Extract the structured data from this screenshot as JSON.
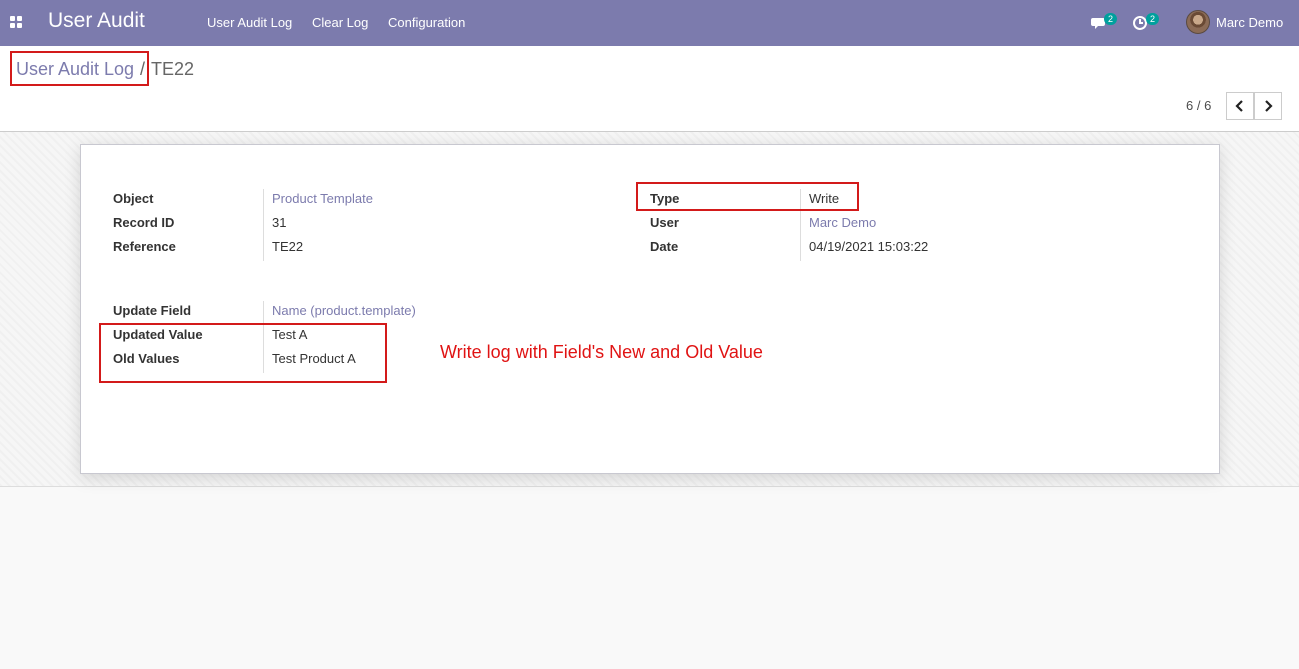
{
  "navbar": {
    "app_name": "User Audit",
    "menu": [
      "User Audit Log",
      "Clear Log",
      "Configuration"
    ],
    "messages_count": "2",
    "activities_count": "2",
    "user_name": "Marc Demo"
  },
  "breadcrumb": {
    "parent": "User Audit Log",
    "separator": "/",
    "current": "TE22"
  },
  "pager": {
    "value": "6 / 6"
  },
  "record": {
    "object_label": "Object",
    "object_value": "Product Template",
    "record_id_label": "Record ID",
    "record_id_value": "31",
    "reference_label": "Reference",
    "reference_value": "TE22",
    "type_label": "Type",
    "type_value": "Write",
    "user_label": "User",
    "user_value": "Marc Demo",
    "date_label": "Date",
    "date_value": "04/19/2021 15:03:22",
    "update_field_label": "Update Field",
    "update_field_value": "Name (product.template)",
    "updated_value_label": "Updated Value",
    "updated_value_value": "Test A",
    "old_values_label": "Old Values",
    "old_values_value": "Test Product A"
  },
  "annotation": "Write log with Field's New and Old Value",
  "colors": {
    "navbar": "#7c7bad",
    "link": "#7c7bad",
    "highlight": "#d31a1a",
    "badge": "#00a09d"
  }
}
